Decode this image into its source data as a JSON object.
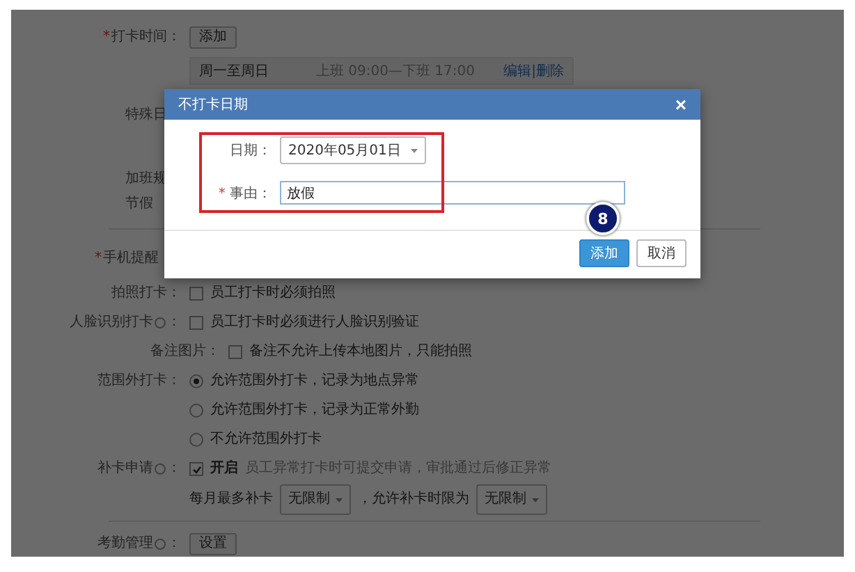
{
  "page": {
    "rows": [
      {
        "kind": "time",
        "marker": "*",
        "label": "打卡时间：",
        "button": "添加",
        "schedule": {
          "days": "周一至周日",
          "hours": "上班 09:00—下班 17:00",
          "actions": [
            "编辑",
            "删除"
          ],
          "separator": "|"
        }
      },
      {
        "kind": "covered",
        "label": "特殊日"
      },
      {
        "kind": "covered",
        "label": "加班规"
      },
      {
        "kind": "covered",
        "label": "节假"
      },
      {
        "kind": "divider"
      },
      {
        "kind": "label",
        "marker": "*",
        "label": "手机提醒"
      },
      {
        "kind": "checkbox",
        "label": "拍照打卡：",
        "checked": false,
        "text": "员工打卡时必须拍照"
      },
      {
        "kind": "checkbox",
        "label": "人脸识别打卡",
        "info": true,
        "suffix": "：",
        "checked": false,
        "text": "员工打卡时必须进行人脸识别验证"
      },
      {
        "kind": "subcheckbox",
        "label": "备注图片：",
        "checked": false,
        "text": "备注不允许上传本地图片，只能拍照"
      },
      {
        "kind": "radio",
        "label": "范围外打卡：",
        "options": [
          {
            "text": "允许范围外打卡，记录为地点异常",
            "selected": true
          },
          {
            "text": "允许范围外打卡，记录为正常外勤",
            "selected": false
          },
          {
            "text": "不允许范围外打卡",
            "selected": false
          }
        ]
      },
      {
        "kind": "makeup",
        "label": "补卡申请",
        "info": true,
        "suffix": "：",
        "checked": true,
        "toggle": "开启",
        "description": "员工异常打卡时可提交申请，审批通过后修正异常",
        "limit_label": "每月最多补卡",
        "limit_value": "无限制",
        "period_label": "，允许补卡时限为",
        "period_value": "无限制"
      },
      {
        "kind": "divider"
      },
      {
        "kind": "button",
        "label": "考勤管理",
        "info": true,
        "suffix": "：",
        "button": "设置"
      }
    ]
  },
  "modal": {
    "title": "不打卡日期",
    "close": "×",
    "fields": [
      {
        "kind": "select",
        "label": "日期：",
        "value": "2020年05月01日"
      },
      {
        "kind": "text",
        "marker": "*",
        "label": "事由：",
        "value": "放假"
      }
    ],
    "step": "8",
    "buttons": [
      {
        "label": "添加",
        "primary": true
      },
      {
        "label": "取消",
        "primary": false
      }
    ]
  }
}
